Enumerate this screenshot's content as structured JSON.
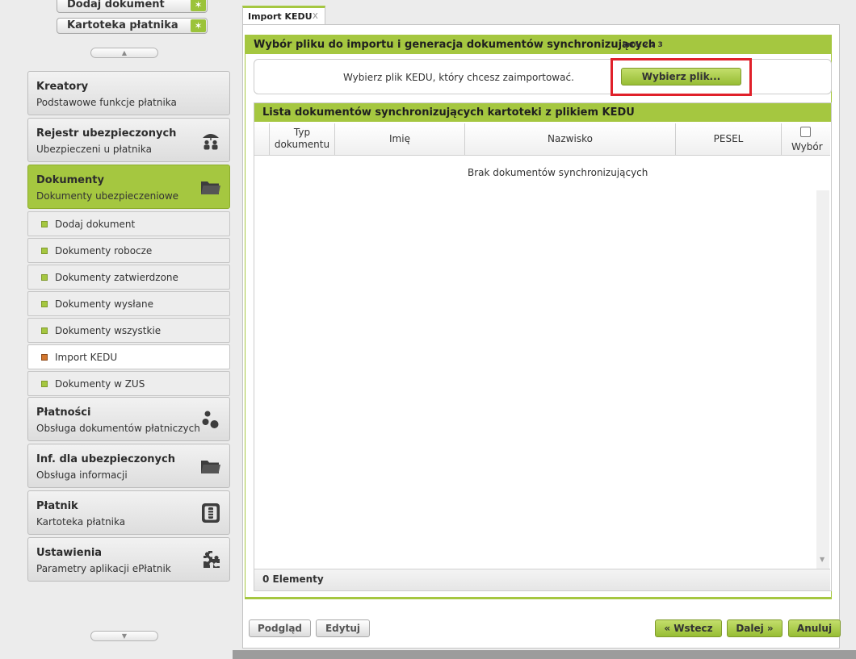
{
  "sidebar": {
    "quick_actions": [
      {
        "label": "Dodaj dokument",
        "icon": "wand-icon"
      },
      {
        "label": "Kartoteka płatnika",
        "icon": "wand-icon"
      }
    ],
    "scroll_up_glyph": "▲",
    "scroll_down_glyph": "▼",
    "categories": {
      "kreatory": {
        "title": "Kreatory",
        "subtitle": "Podstawowe funkcje płatnika"
      },
      "rejestr": {
        "title": "Rejestr ubezpieczonych",
        "subtitle": "Ubezpieczeni u płatnika",
        "icon": "insured-people-icon"
      },
      "dokumenty": {
        "title": "Dokumenty",
        "subtitle": "Dokumenty ubezpieczeniowe",
        "icon": "folder-icon"
      },
      "platnosci": {
        "title": "Płatności",
        "subtitle": "Obsługa dokumentów płatniczych",
        "icon": "coins-icon"
      },
      "inf": {
        "title": "Inf. dla ubezpieczonych",
        "subtitle": "Obsługa informacji",
        "icon": "folder-icon"
      },
      "platnik": {
        "title": "Płatnik",
        "subtitle": "Kartoteka płatnika",
        "icon": "payer-file-icon"
      },
      "ustawienia": {
        "title": "Ustawienia",
        "subtitle": "Parametry aplikacji ePłatnik",
        "icon": "puzzle-icon"
      }
    },
    "doc_items": [
      {
        "label": "Dodaj dokument"
      },
      {
        "label": "Dokumenty robocze"
      },
      {
        "label": "Dokumenty zatwierdzone"
      },
      {
        "label": "Dokumenty wysłane"
      },
      {
        "label": "Dokumenty wszystkie"
      },
      {
        "label": "Import KEDU",
        "active": true
      },
      {
        "label": "Dokumenty w ZUS"
      }
    ]
  },
  "tab": {
    "label": "Import KEDU",
    "close_glyph": "x"
  },
  "wizard": {
    "title": "Wybór pliku do importu i generacja dokumentów synchronizujących",
    "step": "krok 2 z 3",
    "file_prompt": "Wybierz plik KEDU, który chcesz zaimportować.",
    "choose_file_button": "Wybierz plik..."
  },
  "list": {
    "title": "Lista dokumentów synchronizujących kartoteki z plikiem KEDU",
    "columns": {
      "typ_line1": "Typ",
      "typ_line2": "dokumentu",
      "imie": "Imię",
      "nazwisko": "Nazwisko",
      "pesel": "PESEL",
      "wybor": "Wybór"
    },
    "select_all_checked": false,
    "empty_message": "Brak dokumentów synchronizujących",
    "count_label": "0 Elementy"
  },
  "buttons": {
    "preview": "Podgląd",
    "edit": "Edytuj",
    "back": "« Wstecz",
    "next": "Dalej »",
    "cancel": "Anuluj"
  },
  "colors": {
    "accent_green": "#a5c740",
    "highlight_red": "#e0202a",
    "active_bullet": "#d2762d"
  }
}
